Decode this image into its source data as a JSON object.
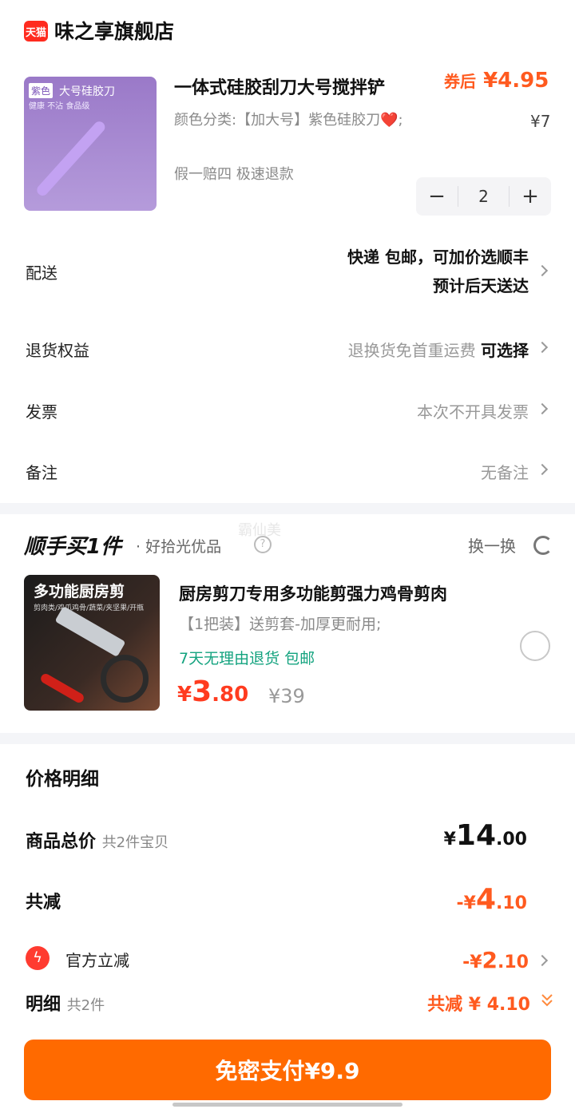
{
  "store": {
    "logo_text": "天猫",
    "name": "味之享旗舰店"
  },
  "product1": {
    "image": {
      "color_tag": "紫色",
      "name": "大号硅胶刀",
      "features": "健康 不沾 食品级"
    },
    "title": "一体式硅胶刮刀大号搅拌铲",
    "coupon_label": "券后",
    "price": "¥4.95",
    "spec": "颜色分类:【加大号】紫色硅胶刀❤️;",
    "original_price": "¥7",
    "service": "假一赔四  极速退款",
    "quantity": "2",
    "minus": "−",
    "plus": "+"
  },
  "rows": {
    "delivery": {
      "label": "配送",
      "line1": "快递 包邮，可加价选顺丰",
      "line2": "预计后天送达"
    },
    "returns": {
      "label": "退货权益",
      "value": "退换货免首重运费",
      "action": "可选择"
    },
    "invoice": {
      "label": "发票",
      "value": "本次不开具发票"
    },
    "note": {
      "label": "备注",
      "value": "无备注"
    }
  },
  "addon": {
    "brand": "顺手买1件",
    "subtitle": "· 好拾光优品",
    "watermark": "霸仙美",
    "swap": "换一换",
    "product": {
      "image_headline": "多功能厨房剪",
      "image_sub": "剪肉类/鸡爪鸡骨/蔬菜/夹坚果/开瓶",
      "title": "厨房剪刀专用多功能剪强力鸡骨剪肉",
      "spec": "【1把装】送剪套-加厚更耐用;",
      "tags": "7天无理由退货  包邮",
      "price_currency": "¥",
      "price_int": "3",
      "price_dec": ".80",
      "original_price": "¥39"
    }
  },
  "price_detail": {
    "title": "价格明细",
    "subtotal": {
      "label": "商品总价",
      "sub": "共2件宝贝",
      "currency": "¥",
      "int": "14",
      "dec": ".00"
    },
    "discount": {
      "label": "共减",
      "prefix": "-¥",
      "int": "4",
      "dec": ".10"
    },
    "official": {
      "label": "官方立减",
      "prefix": "-¥",
      "int": "2",
      "dec": ".10"
    },
    "detail": {
      "label": "明细",
      "sub": "共2件",
      "value": "共减 ¥ 4.10"
    }
  },
  "pay_button": "免密支付¥9.9",
  "colors": {
    "accent": "#ff6a00",
    "price": "#ff5a1f",
    "green": "#14a37f"
  }
}
